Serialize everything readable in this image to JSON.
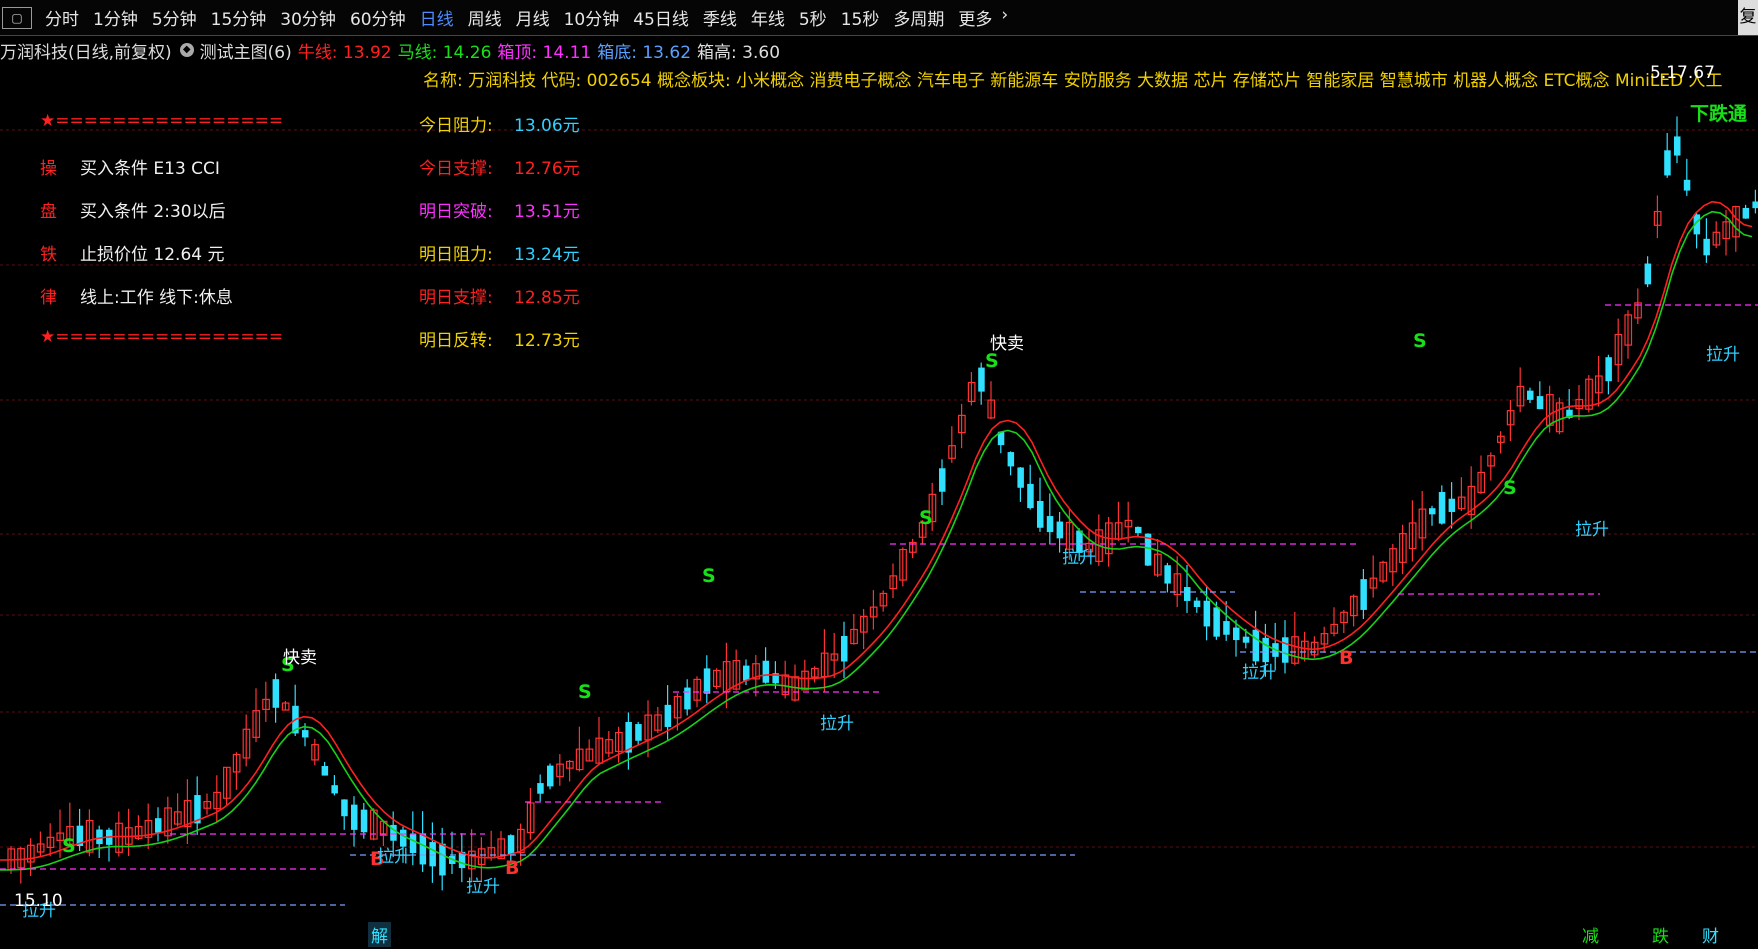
{
  "toolbar": {
    "items": [
      "分时",
      "1分钟",
      "5分钟",
      "15分钟",
      "30分钟",
      "60分钟",
      "日线",
      "周线",
      "月线",
      "10分钟",
      "45日线",
      "季线",
      "年线",
      "5秒",
      "15秒",
      "多周期",
      "更多"
    ],
    "active": "日线",
    "more_icon": "chevron-right-icon",
    "corner": "复"
  },
  "infobar": {
    "stock": "万润科技(日线,前复权)",
    "indicator": "测试主图(6)",
    "niu_label": "牛线:",
    "niu_value": "13.92",
    "ma_label": "马线:",
    "ma_value": "14.26",
    "box_top_label": "箱顶:",
    "box_top_value": "14.11",
    "box_bottom_label": "箱底:",
    "box_bottom_value": "13.62",
    "box_height_label": "箱高:",
    "box_height_value": "3.60"
  },
  "concepts": "名称: 万润科技 代码: 002654 概念板块: 小米概念 消费电子概念 汽车电子 新能源车 安防服务 大数据 芯片 存储芯片 智能家居 智慧城市 机器人概念 ETC概念 MiniLED 人工",
  "left_panel": {
    "star1": "★",
    "sep1": "================",
    "rows": [
      {
        "char": "操",
        "text": "买入条件 E13 CCI"
      },
      {
        "char": "盘",
        "text": "买入条件 2:30以后"
      },
      {
        "char": "铁",
        "text": "止损价位 12.64 元"
      },
      {
        "char": "律",
        "text": "线上:工作 线下:休息"
      }
    ],
    "star2": "★",
    "sep2": "================"
  },
  "levels": [
    {
      "label": "今日阻力:",
      "value": "13.06元",
      "color": "#30d0ff"
    },
    {
      "label": "今日支撑:",
      "value": "12.76元",
      "color": "#ff2020"
    },
    {
      "label": "明日突破:",
      "value": "13.51元",
      "color": "#ff30ff"
    },
    {
      "label": "明日阻力:",
      "value": "13.24元",
      "color": "#30d0ff"
    },
    {
      "label": "明日支撑:",
      "value": "12.85元",
      "color": "#ff2020"
    },
    {
      "label": "明日反转:",
      "value": "12.73元",
      "color": "#f0d000"
    }
  ],
  "chart_labels": {
    "s": "S",
    "b": "B",
    "lasheng": "拉升",
    "kuaimai": "快卖",
    "xiadie": "下跌通",
    "price_tag": "15.10",
    "top_price": "5.17.67"
  },
  "bottom_marks": {
    "jie": "解",
    "jian": "减",
    "die": "跌",
    "cai": "财"
  },
  "colors": {
    "up": "#ff3232",
    "down": "#30e0ff",
    "niu_line": "#ff2020",
    "ma_line": "#18d018",
    "grid": "#5a0f0f"
  }
}
